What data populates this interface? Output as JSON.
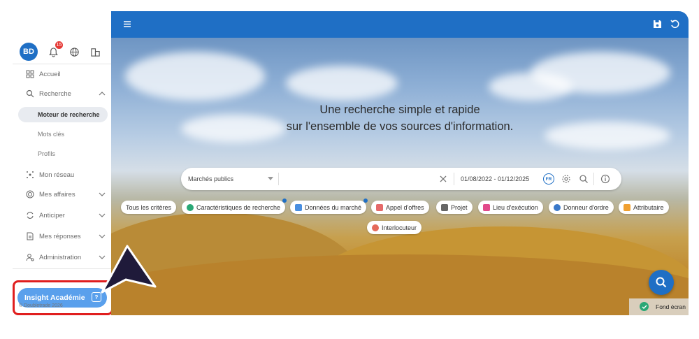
{
  "user": {
    "initials": "BD",
    "notification_count": "15"
  },
  "sidebar": {
    "items": [
      {
        "label": "Accueil"
      },
      {
        "label": "Recherche"
      },
      {
        "label": "Mon réseau"
      },
      {
        "label": "Mes affaires"
      },
      {
        "label": "Anticiper"
      },
      {
        "label": "Mes réponses"
      },
      {
        "label": "Administration"
      }
    ],
    "subitems": [
      {
        "label": "Moteur de recherche",
        "active": true
      },
      {
        "label": "Mots clés"
      },
      {
        "label": "Profils"
      }
    ],
    "academy_label": "Insight Académie",
    "copyright": "© Doubletrade 2026"
  },
  "hero": {
    "headline_line1": "Une recherche simple et rapide",
    "headline_line2": "sur l'ensemble de vos sources d'information."
  },
  "search": {
    "source_select": "Marchés publics",
    "date_range": "01/08/2022 - 01/12/2025",
    "lang": "FR"
  },
  "chips": [
    {
      "label": "Tous les critères"
    },
    {
      "label": "Caractéristiques de recherche"
    },
    {
      "label": "Données du marché"
    },
    {
      "label": "Appel d'offres"
    },
    {
      "label": "Projet"
    },
    {
      "label": "Lieu d'exécution"
    },
    {
      "label": "Donneur d'ordre"
    },
    {
      "label": "Attributaire"
    },
    {
      "label": "Interlocuteur"
    }
  ],
  "background_toggle": {
    "label": "Fond écran"
  },
  "colors": {
    "primary": "#1f6fc5",
    "highlight": "#e01e1e",
    "academy": "#5aa0ec"
  }
}
